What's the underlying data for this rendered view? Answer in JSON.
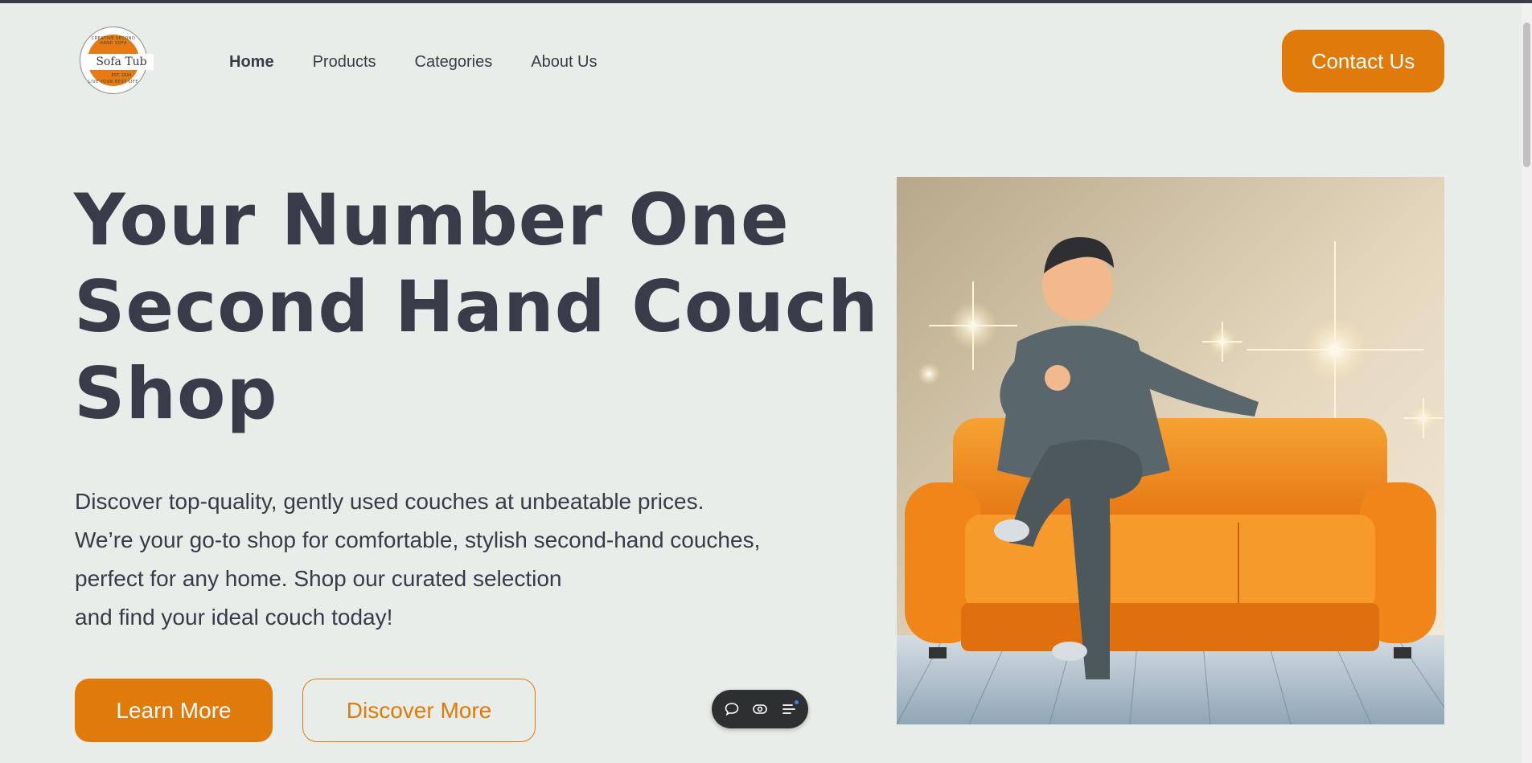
{
  "brand": {
    "name": "Sofa Tub",
    "ring_top": "CREATIVE SECOND HAND SOFA",
    "ring_bottom": "LIVE YOUR BEST LIFE",
    "established": "EST. 2024",
    "accent_color": "#e07b0b",
    "text_color": "#393b49",
    "background": "#e8ede9"
  },
  "nav": {
    "items": [
      {
        "label": "Home",
        "active": true
      },
      {
        "label": "Products"
      },
      {
        "label": "Categories"
      },
      {
        "label": "About Us"
      }
    ],
    "contact_label": "Contact Us"
  },
  "hero": {
    "title_lines": [
      "Your Number One",
      "Second Hand Couch",
      "Shop"
    ],
    "description_lines": [
      "Discover top-quality, gently used couches at unbeatable prices.",
      "We’re your go-to shop for comfortable, stylish second-hand couches,",
      "perfect for any home. Shop our curated selection",
      "and find your ideal couch today!"
    ],
    "primary_button": "Learn More",
    "secondary_button": "Discover More",
    "image_icon": "man-on-orange-sofa-illustration"
  },
  "floating_toolbar": {
    "icons": [
      "comment-icon",
      "eye-icon",
      "menu-icon"
    ]
  }
}
